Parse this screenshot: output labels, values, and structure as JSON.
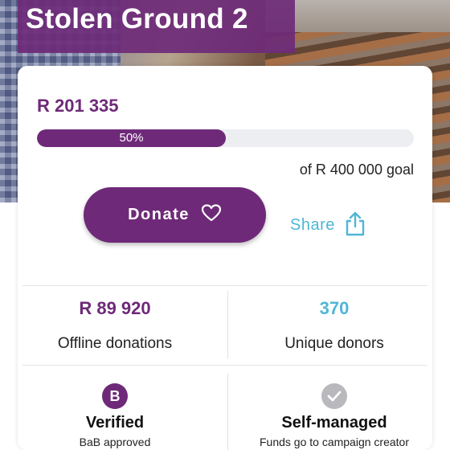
{
  "campaign": {
    "title": "Stolen Ground 2",
    "raised": "R 201 335",
    "progress_fraction": 0.5,
    "progress_label": "50%",
    "goal_text": "of R 400 000 goal"
  },
  "actions": {
    "donate_label": "Donate",
    "share_label": "Share"
  },
  "stats": {
    "offline": {
      "value": "R 89 920",
      "label": "Offline donations"
    },
    "donors": {
      "value": "370",
      "label": "Unique donors"
    }
  },
  "features": {
    "verified": {
      "badge": "B",
      "title": "Verified",
      "subtitle": "BaB approved"
    },
    "self_managed": {
      "title": "Self-managed",
      "subtitle": "Funds go to campaign creator"
    }
  },
  "colors": {
    "brand_purple": "#6e2a78",
    "share_blue": "#4fb6d6",
    "track_gray": "#eceef2",
    "badge_gray": "#b9b9bd"
  },
  "icons": {
    "donate": "heart-icon",
    "share": "share-upload-icon",
    "self_managed": "checkmark-icon"
  }
}
